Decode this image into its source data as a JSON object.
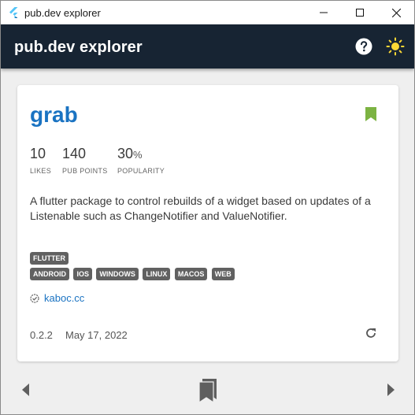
{
  "window": {
    "title": "pub.dev explorer",
    "icons": {
      "app": "flutter-logo-icon",
      "minimize": "minimize-icon",
      "maximize": "maximize-icon",
      "close": "close-icon"
    }
  },
  "appbar": {
    "title": "pub.dev explorer",
    "icons": {
      "help": "help-circle-icon",
      "theme": "sun-icon"
    }
  },
  "package": {
    "name": "grab",
    "stats": [
      {
        "value": "10",
        "suffix": "",
        "label": "LIKES"
      },
      {
        "value": "140",
        "suffix": "",
        "label": "PUB POINTS"
      },
      {
        "value": "30",
        "suffix": "%",
        "label": "POPULARITY"
      }
    ],
    "description": "A flutter package to control rebuilds of a widget based on updates of a Listenable such as ChangeNotifier and ValueNotifier.",
    "sdk_tags": [
      "FLUTTER"
    ],
    "platform_tags": [
      "ANDROID",
      "IOS",
      "WINDOWS",
      "LINUX",
      "MACOS",
      "WEB"
    ],
    "publisher": "kaboc.cc",
    "version": "0.2.2",
    "date": "May 17, 2022",
    "icons": {
      "bookmark": "bookmark-icon",
      "verified": "verified-publisher-icon",
      "refresh": "refresh-icon"
    }
  },
  "bottom_nav": {
    "icons": {
      "prev": "chevron-left-icon",
      "bookmarks": "bookmarks-icon",
      "next": "chevron-right-icon"
    }
  },
  "colors": {
    "appbar_bg": "#172433",
    "link": "#1a73c2",
    "bookmark": "#7cb342",
    "sun": "#fdd835",
    "tag_bg": "#616161"
  }
}
